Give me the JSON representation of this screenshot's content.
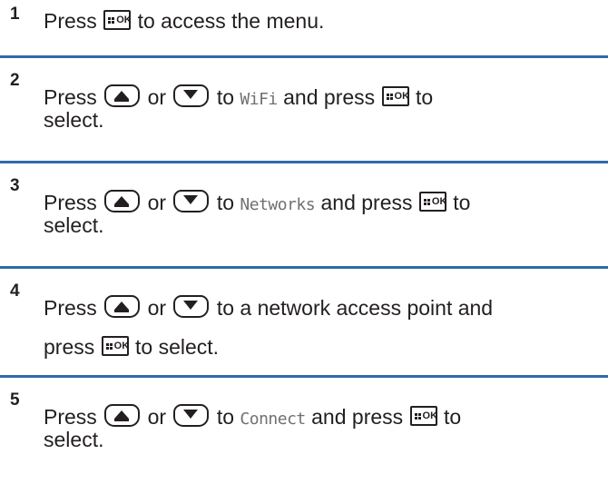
{
  "steps": [
    {
      "number": "1",
      "segments": {
        "press": "Press",
        "after_ok": "to access the menu."
      }
    },
    {
      "number": "2",
      "segments": {
        "press": "Press",
        "or": "or",
        "to": "to",
        "target": "WiFi",
        "and_press": "and press",
        "to2": "to",
        "select": "select."
      }
    },
    {
      "number": "3",
      "segments": {
        "press": "Press",
        "or": "or",
        "to": "to",
        "target": "Networks",
        "and_press": "and press",
        "to2": "to",
        "select": "select."
      }
    },
    {
      "number": "4",
      "segments": {
        "press": "Press",
        "or": "or",
        "to_text": "to a network access point and",
        "press2": "press",
        "select": "to select."
      }
    },
    {
      "number": "5",
      "segments": {
        "press": "Press",
        "or": "or",
        "to": "to",
        "target": "Connect",
        "and_press": "and press",
        "to2": "to",
        "select": "select."
      }
    }
  ],
  "keys": {
    "menu_ok_label": "OK",
    "menu_ok_icon": "menu-ok-key-icon",
    "up_icon": "up-arrow-key-icon",
    "down_icon": "down-arrow-key-icon"
  },
  "colors": {
    "separator": "#2e6aaa",
    "text": "#231f20",
    "ui_text": "#6f7072"
  }
}
